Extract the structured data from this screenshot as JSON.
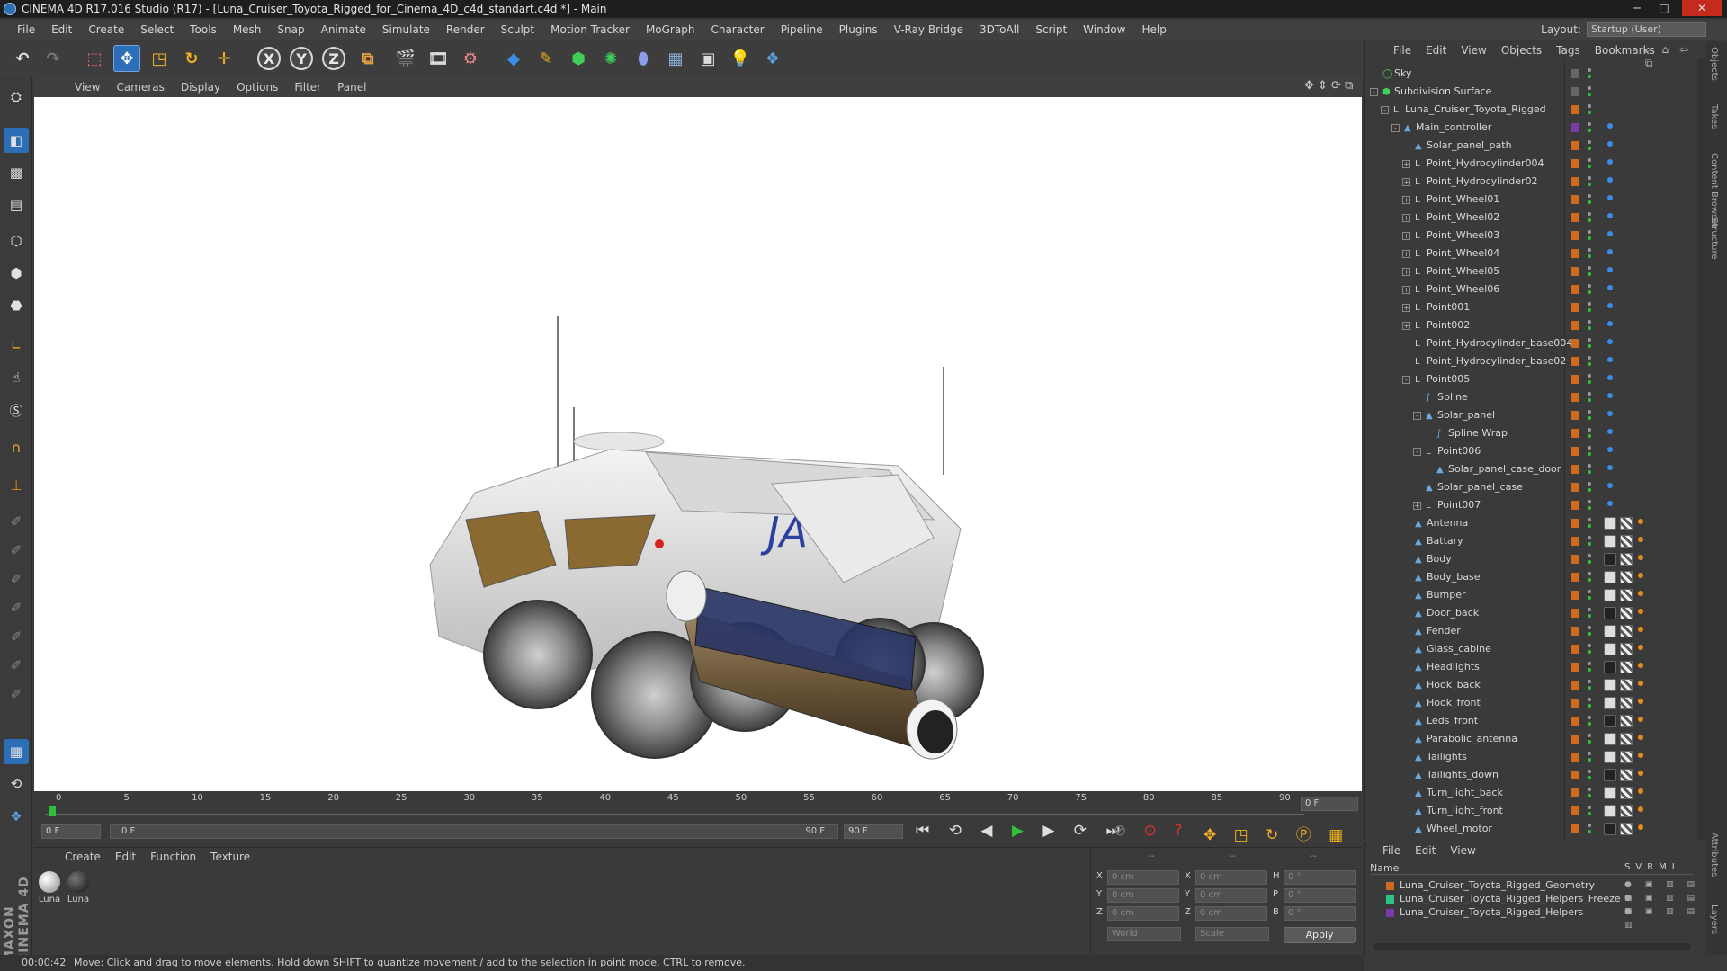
{
  "window": {
    "title": "CINEMA 4D R17.016 Studio (R17) - [Luna_Cruiser_Toyota_Rigged_for_Cinema_4D_c4d_standart.c4d *] - Main",
    "minimize": "─",
    "maximize": "□",
    "close": "✕"
  },
  "menubar": [
    "File",
    "Edit",
    "Create",
    "Select",
    "Tools",
    "Mesh",
    "Snap",
    "Animate",
    "Simulate",
    "Render",
    "Sculpt",
    "Motion Tracker",
    "MoGraph",
    "Character",
    "Pipeline",
    "Plugins",
    "V-Ray Bridge",
    "3DToAll",
    "Script",
    "Window",
    "Help"
  ],
  "layout": {
    "label": "Layout:",
    "value": "Startup (User)"
  },
  "toolbar": {
    "x": "X",
    "y": "Y",
    "z": "Z"
  },
  "viewport_menu": [
    "View",
    "Cameras",
    "Display",
    "Options",
    "Filter",
    "Panel"
  ],
  "timeline": {
    "ticks": [
      "0",
      "5",
      "10",
      "15",
      "20",
      "25",
      "30",
      "35",
      "40",
      "45",
      "50",
      "55",
      "60",
      "65",
      "70",
      "75",
      "80",
      "85",
      "90"
    ],
    "frame_field": "0 F",
    "start_field": "0 F",
    "slider_start": "0 F",
    "slider_end": "90 F",
    "end_field": "90 F",
    "progress": 0
  },
  "material_menu": [
    "Create",
    "Edit",
    "Function",
    "Texture"
  ],
  "materials": [
    {
      "name": "Luna",
      "dark": false
    },
    {
      "name": "Luna",
      "dark": true
    }
  ],
  "coords": {
    "header": [
      "--",
      "--",
      "--"
    ],
    "rows": [
      {
        "a": "X",
        "av": "0 cm",
        "b": "X",
        "bv": "0 cm",
        "c": "H",
        "cv": "0 °"
      },
      {
        "a": "Y",
        "av": "0 cm",
        "b": "Y",
        "bv": "0 cm",
        "c": "P",
        "cv": "0 °"
      },
      {
        "a": "Z",
        "av": "0 cm",
        "b": "Z",
        "bv": "0 cm",
        "c": "B",
        "cv": "0 °"
      }
    ],
    "mode1": "World",
    "mode2": "Scale",
    "apply": "Apply"
  },
  "status": {
    "time": "00:00:42",
    "message": "Move: Click and drag to move elements. Hold down SHIFT to quantize movement / add to the selection in point mode, CTRL to remove."
  },
  "object_menu": [
    "File",
    "Edit",
    "View",
    "Objects",
    "Tags",
    "Bookmarks"
  ],
  "objects": [
    {
      "name": "Sky",
      "depth": 0,
      "icon": "sky",
      "exp": ""
    },
    {
      "name": "Subdivision Surface",
      "depth": 0,
      "icon": "subdiv",
      "exp": "-"
    },
    {
      "name": "Luna_Cruiser_Toyota_Rigged",
      "depth": 1,
      "icon": "null",
      "exp": "-"
    },
    {
      "name": "Main_controller",
      "depth": 2,
      "icon": "joint",
      "exp": "-"
    },
    {
      "name": "Solar_panel_path",
      "depth": 3,
      "icon": "joint",
      "exp": ""
    },
    {
      "name": "Point_Hydrocylinder004",
      "depth": 3,
      "icon": "null",
      "exp": "+"
    },
    {
      "name": "Point_Hydrocylinder02",
      "depth": 3,
      "icon": "null",
      "exp": "+"
    },
    {
      "name": "Point_Wheel01",
      "depth": 3,
      "icon": "null",
      "exp": "+"
    },
    {
      "name": "Point_Wheel02",
      "depth": 3,
      "icon": "null",
      "exp": "+"
    },
    {
      "name": "Point_Wheel03",
      "depth": 3,
      "icon": "null",
      "exp": "+"
    },
    {
      "name": "Point_Wheel04",
      "depth": 3,
      "icon": "null",
      "exp": "+"
    },
    {
      "name": "Point_Wheel05",
      "depth": 3,
      "icon": "null",
      "exp": "+"
    },
    {
      "name": "Point_Wheel06",
      "depth": 3,
      "icon": "null",
      "exp": "+"
    },
    {
      "name": "Point001",
      "depth": 3,
      "icon": "null",
      "exp": "+"
    },
    {
      "name": "Point002",
      "depth": 3,
      "icon": "null",
      "exp": "+"
    },
    {
      "name": "Point_Hydrocylinder_base004",
      "depth": 3,
      "icon": "null",
      "exp": ""
    },
    {
      "name": "Point_Hydrocylinder_base02",
      "depth": 3,
      "icon": "null",
      "exp": ""
    },
    {
      "name": "Point005",
      "depth": 3,
      "icon": "null",
      "exp": "-"
    },
    {
      "name": "Spline",
      "depth": 4,
      "icon": "spline",
      "exp": ""
    },
    {
      "name": "Solar_panel",
      "depth": 4,
      "icon": "joint",
      "exp": "-"
    },
    {
      "name": "Spline Wrap",
      "depth": 5,
      "icon": "spline",
      "exp": ""
    },
    {
      "name": "Point006",
      "depth": 4,
      "icon": "null",
      "exp": "-"
    },
    {
      "name": "Solar_panel_case_door",
      "depth": 5,
      "icon": "joint",
      "exp": ""
    },
    {
      "name": "Solar_panel_case",
      "depth": 4,
      "icon": "joint",
      "exp": ""
    },
    {
      "name": "Point007",
      "depth": 4,
      "icon": "null",
      "exp": "+"
    },
    {
      "name": "Antenna",
      "depth": 3,
      "icon": "joint",
      "exp": ""
    },
    {
      "name": "Battary",
      "depth": 3,
      "icon": "joint",
      "exp": ""
    },
    {
      "name": "Body",
      "depth": 3,
      "icon": "joint",
      "exp": ""
    },
    {
      "name": "Body_base",
      "depth": 3,
      "icon": "joint",
      "exp": ""
    },
    {
      "name": "Bumper",
      "depth": 3,
      "icon": "joint",
      "exp": ""
    },
    {
      "name": "Door_back",
      "depth": 3,
      "icon": "joint",
      "exp": ""
    },
    {
      "name": "Fender",
      "depth": 3,
      "icon": "joint",
      "exp": ""
    },
    {
      "name": "Glass_cabine",
      "depth": 3,
      "icon": "joint",
      "exp": ""
    },
    {
      "name": "Headlights",
      "depth": 3,
      "icon": "joint",
      "exp": ""
    },
    {
      "name": "Hook_back",
      "depth": 3,
      "icon": "joint",
      "exp": ""
    },
    {
      "name": "Hook_front",
      "depth": 3,
      "icon": "joint",
      "exp": ""
    },
    {
      "name": "Leds_front",
      "depth": 3,
      "icon": "joint",
      "exp": ""
    },
    {
      "name": "Parabolic_antenna",
      "depth": 3,
      "icon": "joint",
      "exp": ""
    },
    {
      "name": "Tailights",
      "depth": 3,
      "icon": "joint",
      "exp": ""
    },
    {
      "name": "Tailights_down",
      "depth": 3,
      "icon": "joint",
      "exp": ""
    },
    {
      "name": "Turn_light_back",
      "depth": 3,
      "icon": "joint",
      "exp": ""
    },
    {
      "name": "Turn_light_front",
      "depth": 3,
      "icon": "joint",
      "exp": ""
    },
    {
      "name": "Wheel_motor",
      "depth": 3,
      "icon": "joint",
      "exp": ""
    }
  ],
  "layer_menu": [
    "File",
    "Edit",
    "View"
  ],
  "layer_columns": {
    "name": "Name",
    "flags": [
      "S",
      "V",
      "R",
      "M",
      "L"
    ]
  },
  "layers": [
    {
      "name": "Luna_Cruiser_Toyota_Rigged_Geometry",
      "color": "#d06a1e"
    },
    {
      "name": "Luna_Cruiser_Toyota_Rigged_Helpers_Freeze",
      "color": "#2fc28a"
    },
    {
      "name": "Luna_Cruiser_Toyota_Rigged_Helpers",
      "color": "#7a3aa8"
    }
  ],
  "right_tabs": [
    "Objects",
    "Takes",
    "Content Browser",
    "Structure",
    "Attributes",
    "Layers"
  ],
  "branding": "MAXON CINEMA 4D"
}
